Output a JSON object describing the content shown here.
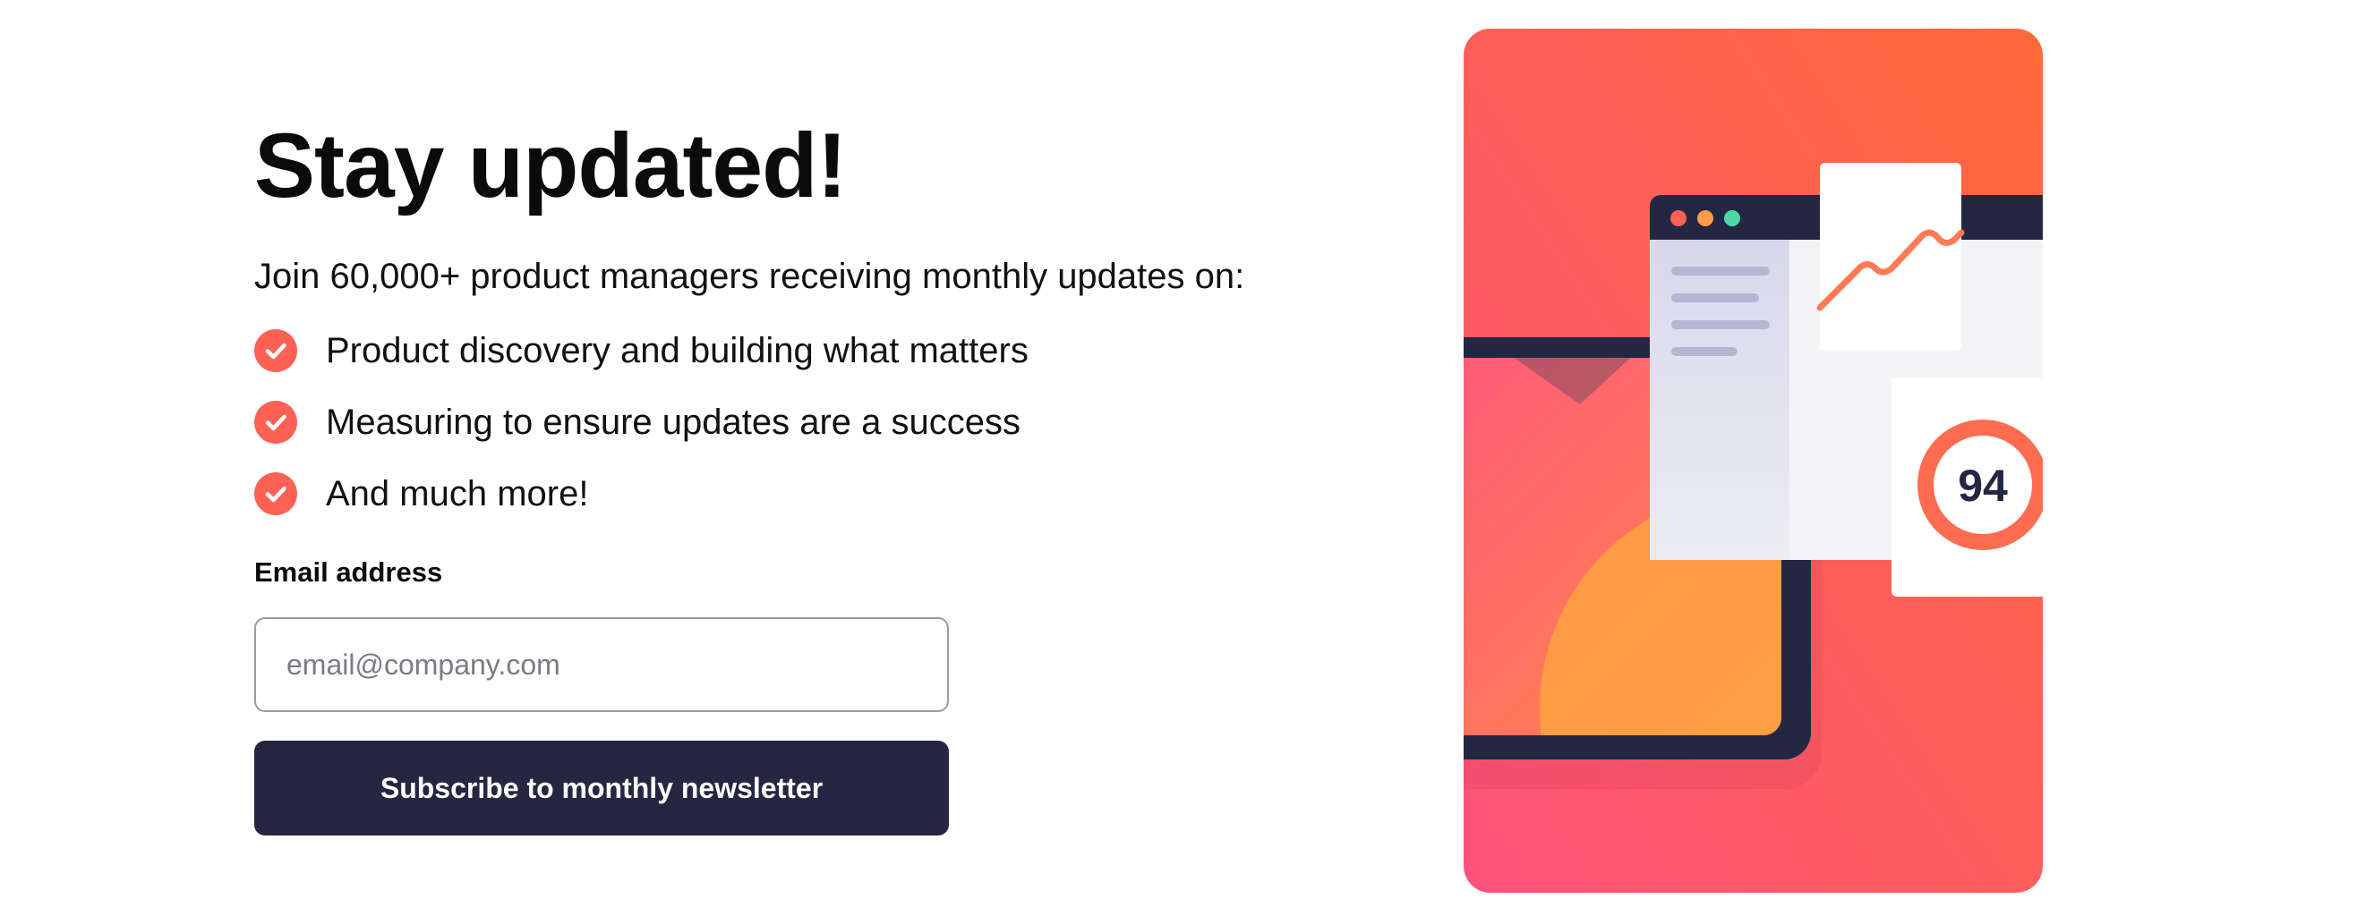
{
  "heading": "Stay updated!",
  "intro": "Join 60,000+ product managers receiving monthly updates on:",
  "features": [
    {
      "text": "Product discovery and building what matters",
      "icon": "check-icon"
    },
    {
      "text": "Measuring to ensure updates are a success",
      "icon": "check-icon"
    },
    {
      "text": "And much more!",
      "icon": "check-icon"
    }
  ],
  "form": {
    "email_label": "Email address",
    "email_placeholder": "email@company.com",
    "email_value": "",
    "submit_label": "Subscribe to monthly newsletter"
  },
  "illustration": {
    "score": "94",
    "score_icon": "score-ring-icon",
    "chart_icon": "trend-line-icon"
  },
  "colors": {
    "accent": "#FF6155",
    "dark_navy": "#242742",
    "grey": "#9A9AA6",
    "gradient_top": "#FF6A3A",
    "gradient_bottom": "#FF527B",
    "dot_red": "#FF6155",
    "dot_orange": "#FF9B4A",
    "dot_green": "#4ED7A4"
  }
}
